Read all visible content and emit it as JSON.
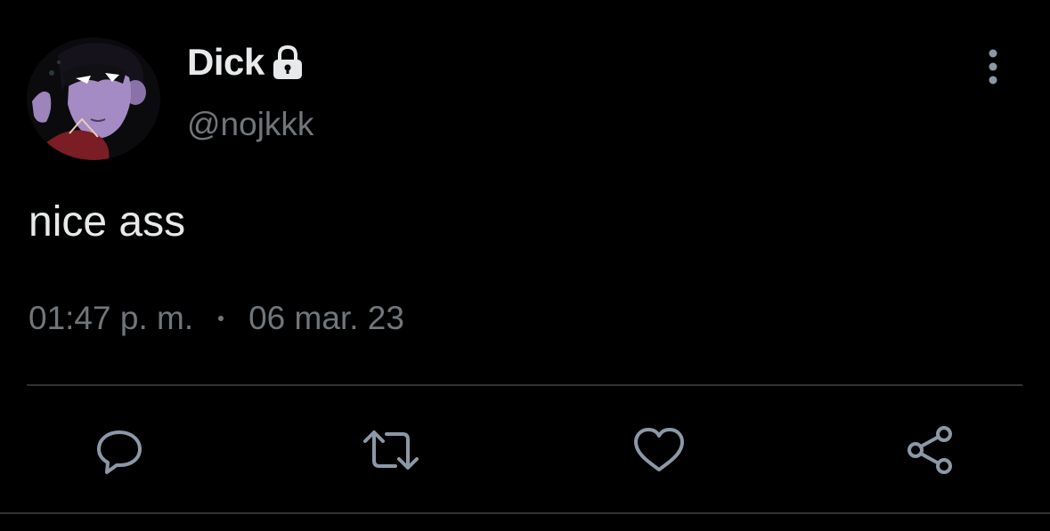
{
  "tweet": {
    "author": {
      "display_name": "Dick",
      "handle": "@nojkkk",
      "protected_icon": "lock-icon",
      "avatar_icon": "avatar-image"
    },
    "text": "nice ass",
    "time": "01:47 p. m.",
    "date": "06 mar. 23",
    "more_icon": "more-vertical-icon",
    "actions": [
      {
        "name": "reply",
        "icon": "reply-icon"
      },
      {
        "name": "retweet",
        "icon": "retweet-icon"
      },
      {
        "name": "like",
        "icon": "heart-icon"
      },
      {
        "name": "share",
        "icon": "share-icon"
      }
    ]
  },
  "colors": {
    "background": "#000000",
    "primary_text": "#e7e9ea",
    "secondary_text": "#71767b",
    "divider": "#2f3336",
    "icon": "#8b98a5"
  }
}
